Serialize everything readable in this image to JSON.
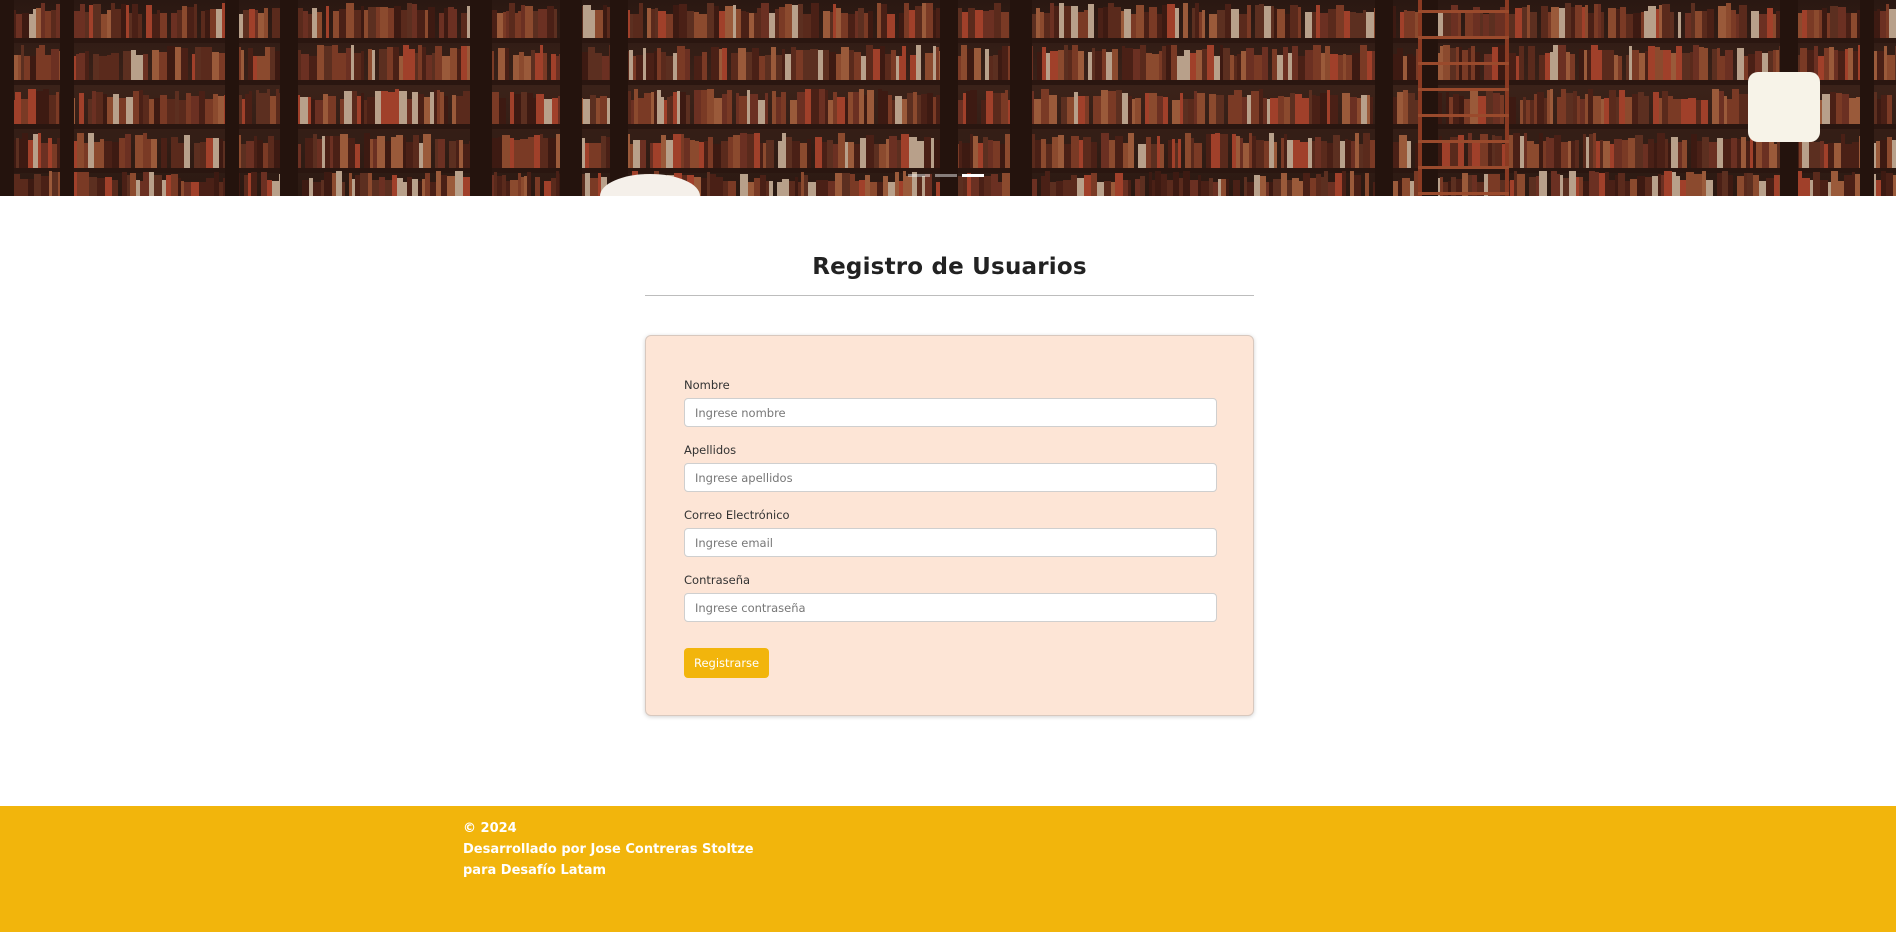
{
  "hero": {
    "image": "library-bookshelves-photo",
    "indicators": [
      {
        "active": false
      },
      {
        "active": false
      },
      {
        "active": true
      }
    ]
  },
  "page": {
    "title": "Registro de Usuarios"
  },
  "form": {
    "fields": [
      {
        "label": "Nombre",
        "placeholder": "Ingrese nombre",
        "value": ""
      },
      {
        "label": "Apellidos",
        "placeholder": "Ingrese apellidos",
        "value": ""
      },
      {
        "label": "Correo Electrónico",
        "placeholder": "Ingrese email",
        "value": ""
      },
      {
        "label": "Contraseña",
        "placeholder": "Ingrese contraseña",
        "value": ""
      }
    ],
    "submit_label": "Registrarse"
  },
  "footer": {
    "copyright": "© 2024",
    "developer": "Desarrollado por Jose Contreras Stoltze",
    "sponsor": "para Desafío Latam"
  },
  "colors": {
    "accent": "#f2b50c",
    "card_background": "#fde5d6",
    "footer_background": "#f2b50c"
  }
}
